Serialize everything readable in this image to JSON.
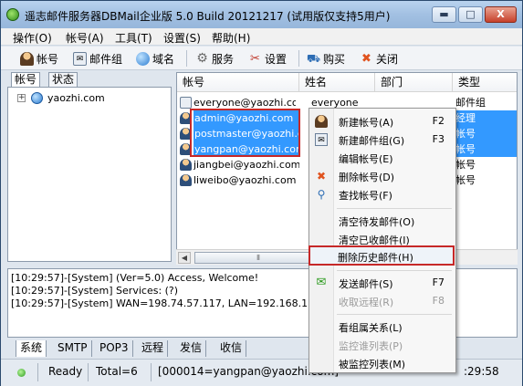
{
  "window": {
    "title": "遥志邮件服务器DBMail企业版 5.0 Build 20121217 (试用版仅支持5用户)",
    "btn_min": "▬",
    "btn_max": "□",
    "btn_close": "X"
  },
  "menu": [
    "操作(O)",
    "帐号(A)",
    "工具(T)",
    "设置(S)",
    "帮助(H)"
  ],
  "toolbar": {
    "account": "帐号",
    "mailgroup": "邮件组",
    "domain": "域名",
    "service": "服务",
    "settings": "设置",
    "buy": "购买",
    "close": "关闭"
  },
  "left_tabs": [
    "帐号",
    "状态"
  ],
  "tree": {
    "expander": "+",
    "domain": "yaozhi.com"
  },
  "list": {
    "columns": [
      "帐号",
      "姓名",
      "部门",
      "类型"
    ],
    "rows": [
      {
        "account": "everyone@yaozhi.com",
        "name": "everyone",
        "dept": "",
        "type": "邮件组",
        "icon": "mailgroup-icon",
        "selected": false
      },
      {
        "account": "admin@yaozhi.com",
        "name": "",
        "dept": "",
        "type": "经理",
        "icon": "user-icon",
        "selected": true
      },
      {
        "account": "postmaster@yaozhi.c...",
        "name": "",
        "dept": "",
        "type": "帐号",
        "icon": "user-icon",
        "selected": true
      },
      {
        "account": "yangpan@yaozhi.com",
        "name": "",
        "dept": "",
        "type": "帐号",
        "icon": "user-icon",
        "selected": true
      },
      {
        "account": "jiangbei@yaozhi.com",
        "name": "",
        "dept": "",
        "type": "帐号",
        "icon": "user-icon",
        "selected": false
      },
      {
        "account": "liweibo@yaozhi.com",
        "name": "",
        "dept": "",
        "type": "帐号",
        "icon": "user-icon",
        "selected": false
      }
    ]
  },
  "scroll": {
    "left_arrow": "◀",
    "thumb": "⦀"
  },
  "log": [
    "[10:29:57]-[System] (Ver=5.0) Access, Welcome!",
    "[10:29:57]-[System] Services: (?)",
    "[10:29:57]-[System] WAN=198.74.57.117, LAN=192.168.1.105, 192."
  ],
  "bottom_tabs": [
    "系统",
    "SMTP",
    "POP3",
    "远程",
    "发信",
    "收信"
  ],
  "status": {
    "state": "Ready",
    "total": "Total=6",
    "current": "[000014=yangpan@yaozhi.com]",
    "time": ":29:58"
  },
  "context_menu": {
    "new_account": {
      "label": "新建帐号(A)",
      "key": "F2"
    },
    "new_group": {
      "label": "新建邮件组(G)",
      "key": "F3"
    },
    "edit_account": {
      "label": "编辑帐号(E)"
    },
    "delete_account": {
      "label": "删除帐号(D)"
    },
    "find_account": {
      "label": "查找帐号(F)"
    },
    "clear_pending": {
      "label": "清空待发邮件(O)"
    },
    "clear_received": {
      "label": "清空已收邮件(I)"
    },
    "delete_history": {
      "label": "删除历史邮件(H)"
    },
    "send_mail": {
      "label": "发送邮件(S)",
      "key": "F7"
    },
    "receive_remote": {
      "label": "收取远程(R)",
      "key": "F8"
    },
    "view_groups": {
      "label": "看组属关系(L)"
    },
    "monitor_whom": {
      "label": "监控谁列表(P)"
    },
    "monitored_list": {
      "label": "被监控列表(M)"
    }
  },
  "colors": {
    "selection": "#3399ff",
    "highlight_box": "#c62828"
  }
}
